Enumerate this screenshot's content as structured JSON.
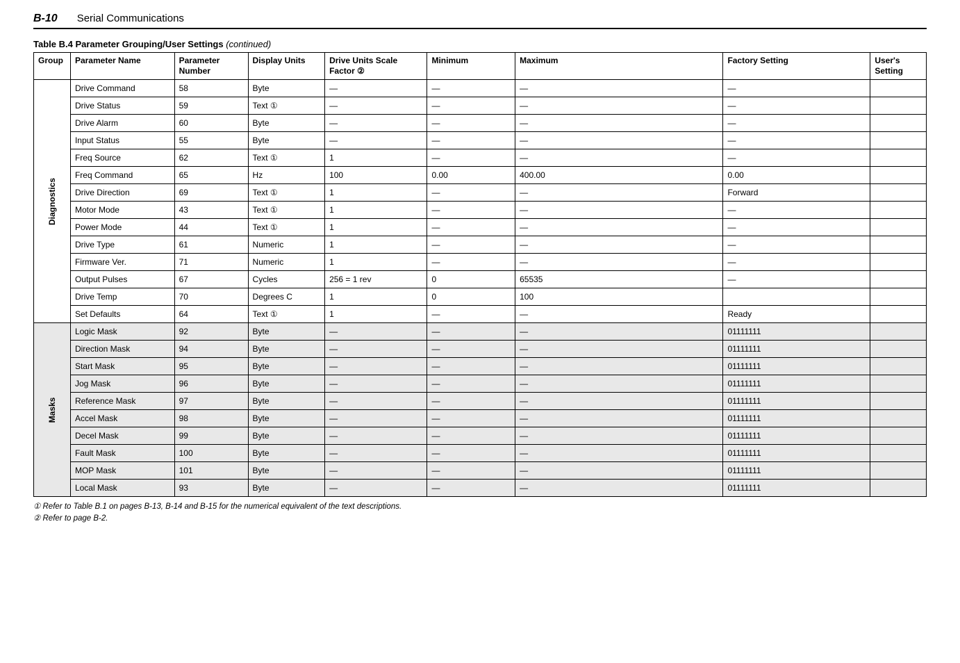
{
  "header": {
    "page_number": "B-10",
    "section": "Serial Communications",
    "table_caption": "Table B.4  Parameter Grouping/User Settings",
    "table_caption_suffix": "(continued)"
  },
  "columns": {
    "group": "Group",
    "name": "Parameter Name",
    "pnum": "Parameter Number",
    "units": "Display Units",
    "scale": "Drive Units Scale Factor ②",
    "min": "Minimum",
    "max": "Maximum",
    "factory": "Factory Setting",
    "user": "User's Setting"
  },
  "groups": [
    {
      "label": "Diagnostics",
      "shaded": false,
      "rows": [
        {
          "name": "Drive Command",
          "pnum": "58",
          "units": "Byte",
          "scale": "—",
          "min": "—",
          "max": "—",
          "factory": "—",
          "user": ""
        },
        {
          "name": "Drive Status",
          "pnum": "59",
          "units": "Text ①",
          "scale": "—",
          "min": "—",
          "max": "—",
          "factory": "—",
          "user": ""
        },
        {
          "name": "Drive Alarm",
          "pnum": "60",
          "units": "Byte",
          "scale": "—",
          "min": "—",
          "max": "—",
          "factory": "—",
          "user": ""
        },
        {
          "name": "Input Status",
          "pnum": "55",
          "units": "Byte",
          "scale": "—",
          "min": "—",
          "max": "—",
          "factory": "—",
          "user": ""
        },
        {
          "name": "Freq Source",
          "pnum": "62",
          "units": "Text ①",
          "scale": "1",
          "min": "—",
          "max": "—",
          "factory": "—",
          "user": ""
        },
        {
          "name": "Freq Command",
          "pnum": "65",
          "units": "Hz",
          "scale": "100",
          "min": "0.00",
          "max": "400.00",
          "factory": "0.00",
          "user": ""
        },
        {
          "name": "Drive Direction",
          "pnum": "69",
          "units": "Text  ①",
          "scale": "1",
          "min": "—",
          "max": "—",
          "factory": "Forward",
          "user": ""
        },
        {
          "name": "Motor Mode",
          "pnum": "43",
          "units": "Text  ①",
          "scale": "1",
          "min": "—",
          "max": "—",
          "factory": "—",
          "user": ""
        },
        {
          "name": "Power Mode",
          "pnum": "44",
          "units": "Text  ①",
          "scale": "1",
          "min": "—",
          "max": "—",
          "factory": "—",
          "user": ""
        },
        {
          "name": "Drive Type",
          "pnum": "61",
          "units": "Numeric",
          "scale": "1",
          "min": "—",
          "max": "—",
          "factory": "—",
          "user": ""
        },
        {
          "name": "Firmware Ver.",
          "pnum": "71",
          "units": "Numeric",
          "scale": "1",
          "min": "—",
          "max": "—",
          "factory": "—",
          "user": ""
        },
        {
          "name": "Output Pulses",
          "pnum": "67",
          "units": "Cycles",
          "scale": "256 = 1 rev",
          "min": "0",
          "max": "65535",
          "factory": "—",
          "user": ""
        },
        {
          "name": "Drive Temp",
          "pnum": "70",
          "units": "Degrees C",
          "scale": "1",
          "min": "0",
          "max": "100",
          "factory": "",
          "user": ""
        },
        {
          "name": "Set Defaults",
          "pnum": "64",
          "units": "Text ①",
          "scale": "1",
          "min": "—",
          "max": "—",
          "factory": "Ready",
          "user": ""
        }
      ]
    },
    {
      "label": "Masks",
      "shaded": true,
      "rows": [
        {
          "name": "Logic Mask",
          "pnum": "92",
          "units": "Byte",
          "scale": "—",
          "min": "—",
          "max": "—",
          "factory": "01111111",
          "user": ""
        },
        {
          "name": "Direction Mask",
          "pnum": "94",
          "units": "Byte",
          "scale": "—",
          "min": "—",
          "max": "—",
          "factory": "01111111",
          "user": ""
        },
        {
          "name": "Start Mask",
          "pnum": "95",
          "units": "Byte",
          "scale": "—",
          "min": "—",
          "max": "—",
          "factory": "01111111",
          "user": ""
        },
        {
          "name": "Jog Mask",
          "pnum": "96",
          "units": "Byte",
          "scale": "—",
          "min": "—",
          "max": "—",
          "factory": "01111111",
          "user": ""
        },
        {
          "name": "Reference Mask",
          "pnum": "97",
          "units": "Byte",
          "scale": "—",
          "min": "—",
          "max": "—",
          "factory": "01111111",
          "user": ""
        },
        {
          "name": "Accel Mask",
          "pnum": "98",
          "units": "Byte",
          "scale": "—",
          "min": "—",
          "max": "—",
          "factory": "01111111",
          "user": ""
        },
        {
          "name": "Decel Mask",
          "pnum": "99",
          "units": "Byte",
          "scale": "—",
          "min": "—",
          "max": "—",
          "factory": "01111111",
          "user": ""
        },
        {
          "name": "Fault Mask",
          "pnum": "100",
          "units": "Byte",
          "scale": "—",
          "min": "—",
          "max": "—",
          "factory": "01111111",
          "user": ""
        },
        {
          "name": "MOP Mask",
          "pnum": "101",
          "units": "Byte",
          "scale": "—",
          "min": "—",
          "max": "—",
          "factory": "01111111",
          "user": ""
        },
        {
          "name": "Local Mask",
          "pnum": "93",
          "units": "Byte",
          "scale": "—",
          "min": "—",
          "max": "—",
          "factory": "01111111",
          "user": ""
        }
      ]
    }
  ],
  "footnotes": {
    "f1": "①  Refer to Table B.1  on pages B-13,  B-14 and B-15 for the numerical equivalent of the text descriptions.",
    "f2": "②  Refer to page B-2."
  }
}
